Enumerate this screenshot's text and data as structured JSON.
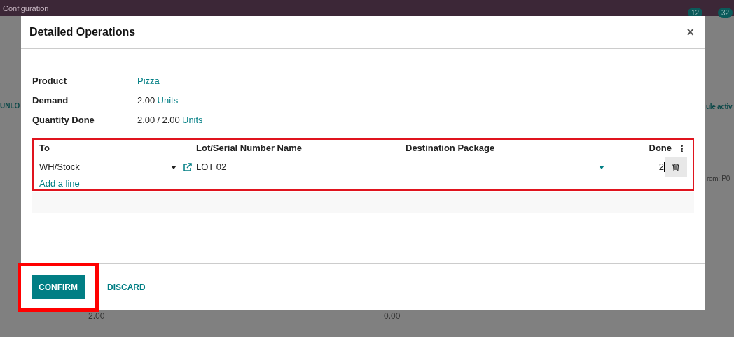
{
  "background": {
    "app_title": "Configuration",
    "badges": [
      "12",
      "32"
    ],
    "left_button": "UNLO",
    "right_text": "ule activ",
    "right_field": "rom: P0",
    "row": {
      "quantity": "2.00",
      "done": "0.00"
    }
  },
  "dialog": {
    "title": "Detailed Operations",
    "close": "×",
    "fields": [
      {
        "label": "Product",
        "parts": [
          {
            "text": "Pizza",
            "kind": "link"
          }
        ]
      },
      {
        "label": "Demand",
        "parts": [
          {
            "text": "2.00",
            "kind": "plain"
          },
          {
            "text": "Units",
            "kind": "link"
          }
        ]
      },
      {
        "label": "Quantity Done",
        "parts": [
          {
            "text": "2.00",
            "kind": "plain"
          },
          {
            "text": "/",
            "kind": "plain"
          },
          {
            "text": "2.00",
            "kind": "plain"
          },
          {
            "text": "Units",
            "kind": "link"
          }
        ]
      }
    ],
    "table": {
      "highlighted": true,
      "columns": [
        "To",
        "Lot/Serial Number Name",
        "Destination Package",
        "Done"
      ],
      "rows": [
        {
          "to": "WH/Stock",
          "lot": "LOT 02",
          "package": "",
          "done": "2"
        }
      ],
      "add_line": "Add a line"
    },
    "buttons": [
      {
        "label": "CONFIRM",
        "kind": "primary",
        "highlighted": true
      },
      {
        "label": "DISCARD",
        "kind": "link",
        "highlighted": false
      }
    ]
  }
}
